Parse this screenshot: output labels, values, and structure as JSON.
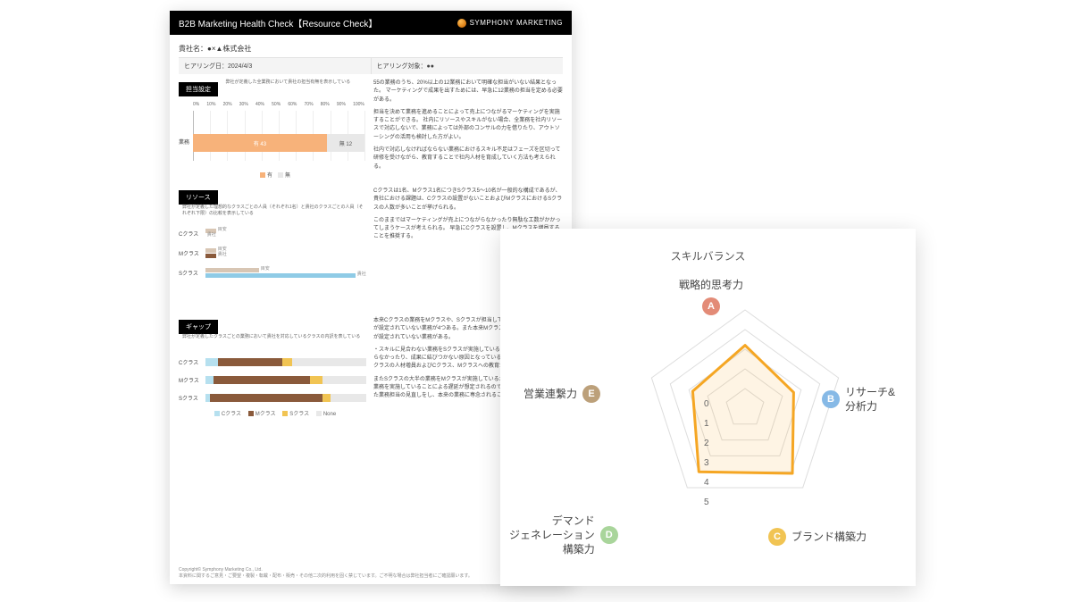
{
  "doc": {
    "title": "B2B Marketing Health Check【Resource Check】",
    "brand": "SYMPHONY MARKETING",
    "company": "貴社名：●×▲株式会社",
    "hearing_date": "ヒアリング日：2024/4/3",
    "hearing_target": "ヒアリング対象：●●",
    "footer1": "Copyright© Symphony Marketing Co., Ltd.",
    "footer2": "本資料に関するご意見・ご要望・複製・転載・配布・販売・その他二次的利用を固く禁じています。ご不明な場合は弊社担当者にご確認願います。",
    "sections": {
      "s1": {
        "label": "担当設定",
        "sub": "弊社が定義した全業務において貴社の担当有無を表示している"
      },
      "s2": {
        "label": "リソース",
        "sub": "弊社が定義した理想的なクラスごとの人員（それぞれ1名）と貴社のクラスごとの人員（それぞれ下限）の比較を表示している"
      },
      "s3": {
        "label": "ギャップ",
        "sub": "弊社が定義したクラスごとの業務において貴社を対応しているクラスの内訳を表している"
      }
    },
    "comments": {
      "c1a": "55の業務のうち、20%以上の12業務において明確な担当がいない結果となった。\nマーケティングで成果を出すためには、早急に12業務の担当を定める必要がある。",
      "c1b": "担当を決めて業務を進めることによって売上につながるマーケティングを実施することができる。\n社内にリソースやスキルがない場合、全業務を社内リソースで対応しないで、業務によっては外部のコンサルの力を借りたり、アウトソーシングの活用も検討した方がよい。",
      "c1c": "社内で対応しなければならない業務におけるスキル不足はフェーズを区切って研修を受けながら、教育することで社内人材を育成していく方法も考えられる。",
      "c2a": "Cクラスは1名、Mクラス1名につきSクラス5〜10名が一般的な構成であるが、貴社における課題は、Cクラスの設置がないことおよびMクラスにおけるSクラスの人数が多いことが挙げられる。",
      "c2b": "このままではマーケティングが売上につながらなかったり無駄な工数がかかってしまうケースが考えられる。\n早急にCクラスを設置し、Mクラスを増員することを推奨する。",
      "c3a": "本来Cクラスの業務をMクラスや、Sクラスが担当していることもあるが、担当が設定されていない業務が4つある。また本来Mクラスが実施すべき業務の担当が設定されていない業務がある。",
      "c3b": "・スキルに見合わない業務をSクラスが実施していることで、業務効率があがらなかったり、成果に結びつかない原因となっている。\n・Cクラスの設定、Mクラスの人材増員およびCクラス、Mクラスへの教育が急務であると考える。",
      "c3c": "またSクラスの大半の業務をMクラスが実施しているため、スキルにあわない業務を実施していることによる遅延が想定されるので、速やかにスキルにあった業務担当の見直しをし、本来の業務に専念されることを推奨する。"
    }
  },
  "chart_data": [
    {
      "type": "bar",
      "title": "担当設定",
      "orientation": "horizontal",
      "stacked": true,
      "ylabel": "業務",
      "ticks": [
        "0%",
        "10%",
        "20%",
        "30%",
        "40%",
        "50%",
        "60%",
        "70%",
        "80%",
        "90%",
        "100%"
      ],
      "series": [
        {
          "name": "有",
          "value": 43,
          "pct": 78,
          "color": "#f7b27a"
        },
        {
          "name": "無",
          "value": 12,
          "pct": 22,
          "color": "#e8e8e8"
        }
      ],
      "legend": [
        "有",
        "無"
      ]
    },
    {
      "type": "bar",
      "title": "リソース",
      "orientation": "horizontal",
      "xlim": [
        0,
        15
      ],
      "categories": [
        "Cクラス",
        "Mクラス",
        "Sクラス"
      ],
      "series": [
        {
          "name": "目安",
          "color": "#d8c6b4",
          "values": [
            1,
            1,
            5
          ]
        },
        {
          "name": "貴社",
          "color": "#8a5a3b",
          "values": [
            0,
            1,
            14
          ]
        }
      ],
      "note": "Sクラス貴社バーは #8fcbe6"
    },
    {
      "type": "bar",
      "title": "ギャップ",
      "orientation": "horizontal",
      "stacked": true,
      "xlim": [
        0,
        100
      ],
      "categories": [
        "Cクラス",
        "Mクラス",
        "Sクラス"
      ],
      "legend": [
        "Cクラス",
        "Mクラス",
        "Sクラス",
        "None"
      ],
      "colors": {
        "Cクラス": "#b6e0ef",
        "Mクラス": "#8a5a3b",
        "Sクラス": "#f1c453",
        "None": "#e8e8e8"
      },
      "rows": [
        {
          "label": "Cクラス",
          "seg": [
            [
              "Cクラス",
              8
            ],
            [
              "Mクラス",
              40
            ],
            [
              "Sクラス",
              6
            ],
            [
              "None",
              46
            ]
          ]
        },
        {
          "label": "Mクラス",
          "seg": [
            [
              "Cクラス",
              5
            ],
            [
              "Mクラス",
              60
            ],
            [
              "Sクラス",
              8
            ],
            [
              "None",
              27
            ]
          ]
        },
        {
          "label": "Sクラス",
          "seg": [
            [
              "Cクラス",
              3
            ],
            [
              "Mクラス",
              70
            ],
            [
              "Sクラス",
              5
            ],
            [
              "None",
              22
            ]
          ]
        }
      ]
    },
    {
      "type": "radar",
      "title": "スキルバランス",
      "max": 5,
      "rings": [
        0,
        1,
        2,
        3,
        4,
        5
      ],
      "axes": [
        {
          "letter": "A",
          "label": "戦略的思考力",
          "color": "#e38b77"
        },
        {
          "letter": "B",
          "label": "リサーチ&\n分析力",
          "color": "#86b9e6"
        },
        {
          "letter": "C",
          "label": "ブランド構築力",
          "color": "#f1c453"
        },
        {
          "letter": "D",
          "label": "デマンド\nジェネレーション\n構築力",
          "color": "#a9d59b"
        },
        {
          "letter": "E",
          "label": "営業連繋力",
          "color": "#bca07a"
        }
      ],
      "values": [
        3.2,
        2.6,
        4.1,
        4.0,
        2.8
      ],
      "line_color": "#f5a623"
    }
  ]
}
